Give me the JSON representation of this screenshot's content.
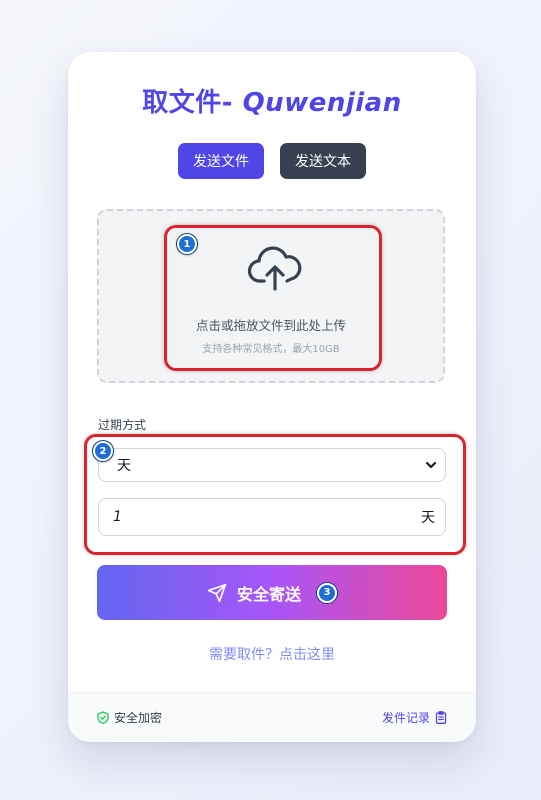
{
  "title": {
    "cn": "取文件-",
    "latin": " Quwenjian"
  },
  "tabs": [
    {
      "label": "发送文件",
      "active": true
    },
    {
      "label": "发送文本",
      "active": false
    }
  ],
  "upload": {
    "icon": "cloud-upload-icon",
    "main_text": "点击或拖放文件到此处上传",
    "sub_text": "支持各种常见格式，最大10GB"
  },
  "expiry": {
    "label": "过期方式",
    "selected": "天",
    "value": "1",
    "unit": "天"
  },
  "send_button": {
    "label": "安全寄送",
    "icon": "paper-plane-icon"
  },
  "retrieve_link": "需要取件？点击这里",
  "footer": {
    "secure_label": "安全加密",
    "history_label": "发件记录"
  },
  "annotations": {
    "badge_1": "1",
    "badge_2": "2",
    "badge_3": "3"
  },
  "colors": {
    "accent": "#4f46e5",
    "dark_tab": "#374151",
    "highlight": "#d9232d",
    "gradient_start": "#6366f1",
    "gradient_end": "#ec4899"
  }
}
